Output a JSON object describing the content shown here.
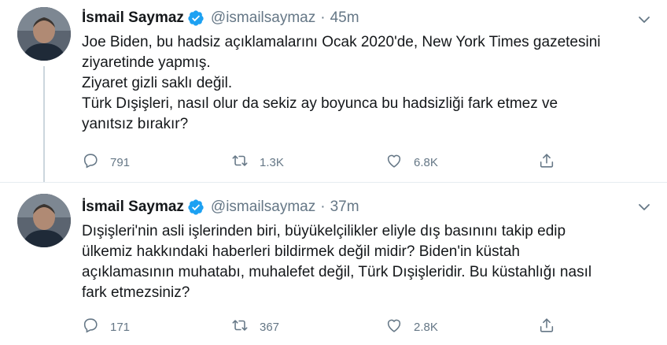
{
  "tweets": [
    {
      "author": {
        "name": "İsmail Saymaz",
        "handle": "@ismailsaymaz",
        "verified": true
      },
      "separator": "·",
      "time": "45m",
      "lines": [
        "Joe Biden, bu hadsiz açıklamalarını Ocak 2020'de, New York Times gazetesini",
        "ziyaretinde yapmış.",
        "Ziyaret gizli saklı değil.",
        "Türk Dışişleri, nasıl olur da sekiz ay boyunca bu hadsizliği fark etmez ve",
        "yanıtsız bırakır?"
      ],
      "actions": {
        "reply_count": "791",
        "retweet_count": "1.3K",
        "like_count": "6.8K"
      }
    },
    {
      "author": {
        "name": "İsmail Saymaz",
        "handle": "@ismailsaymaz",
        "verified": true
      },
      "separator": "·",
      "time": "37m",
      "lines": [
        "Dışişleri'nin asli işlerinden biri, büyükelçilikler eliyle dış basınını takip edip",
        "ülkemiz hakkındaki haberleri bildirmek değil midir? Biden'in küstah",
        "açıklamasının muhatabı, muhalefet değil, Türk Dışişleridir. Bu küstahlığı nasıl",
        "fark etmezsiniz?"
      ],
      "actions": {
        "reply_count": "171",
        "retweet_count": "367",
        "like_count": "2.8K"
      }
    }
  ],
  "icons": {
    "verified": "verified-badge-icon",
    "caret": "chevron-down-icon",
    "reply": "reply-icon",
    "retweet": "retweet-icon",
    "like": "heart-icon",
    "share": "share-icon"
  },
  "colors": {
    "text": "#14171a",
    "secondary": "#657786",
    "verified": "#1da1f2",
    "divider": "#e6ecf0",
    "thread_line": "#ccd6dd"
  }
}
